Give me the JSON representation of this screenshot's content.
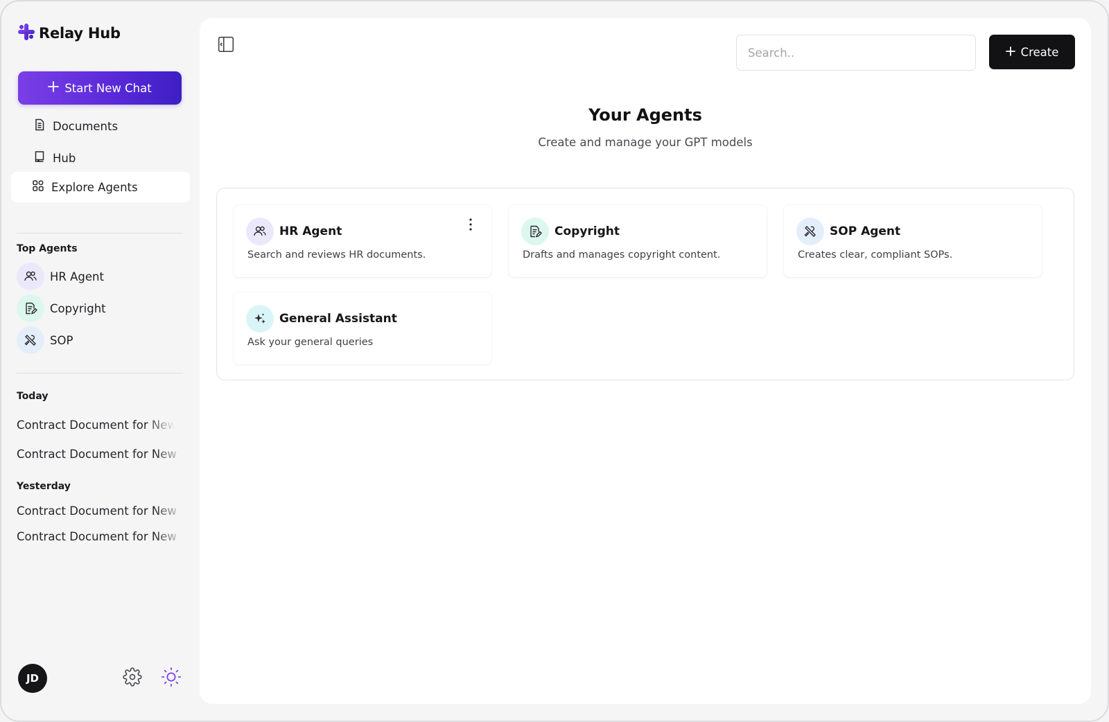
{
  "app": {
    "title": "Relay Hub"
  },
  "sidebar": {
    "new_chat_label": "Start New Chat",
    "nav": [
      {
        "label": "Documents",
        "icon": "document-icon"
      },
      {
        "label": "Hub",
        "icon": "book-icon"
      },
      {
        "label": "Explore Agents",
        "icon": "grid-icon",
        "active": true
      }
    ],
    "top_agents_label": "Top Agents",
    "top_agents": [
      {
        "label": "HR Agent",
        "icon": "users-icon"
      },
      {
        "label": "Copyright",
        "icon": "document-edit-icon"
      },
      {
        "label": "SOP",
        "icon": "tools-icon"
      }
    ],
    "today_label": "Today",
    "today": [
      "Contract Document for New",
      "Contract Document for New"
    ],
    "yesterday_label": "Yesterday",
    "yesterday": [
      "Contract Document for New",
      "Contract Document for New"
    ],
    "user_initials": "JD"
  },
  "main": {
    "search_placeholder": "Search..",
    "create_label": "Create",
    "title": "Your Agents",
    "subtitle": "Create and manage your GPT models",
    "agents": [
      {
        "name": "HR Agent",
        "description": "Search and reviews HR documents.",
        "icon": "users-icon"
      },
      {
        "name": "Copyright",
        "description": "Drafts and manages copyright content.",
        "icon": "document-edit-icon"
      },
      {
        "name": "SOP Agent",
        "description": "Creates clear, compliant SOPs.",
        "icon": "tools-icon"
      },
      {
        "name": "General Assistant",
        "description": "Ask your general queries",
        "icon": "sparkles-icon"
      }
    ]
  },
  "colors": {
    "brand_gradient_start": "#7a3fe6",
    "brand_gradient_end": "#3d1fc4",
    "create_button": "#121214",
    "theme_icon": "#7b3fe4"
  }
}
